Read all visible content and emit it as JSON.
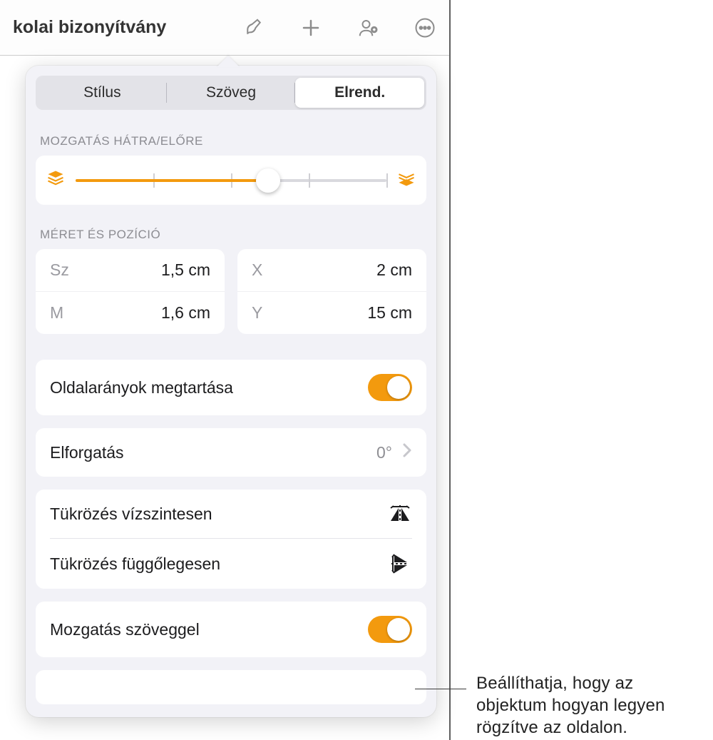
{
  "topbar": {
    "title": "kolai bizonyítvány"
  },
  "tabs": {
    "style": "Stílus",
    "text": "Szöveg",
    "layout": "Elrend."
  },
  "sections": {
    "move_label": "MOZGATÁS HÁTRA/ELŐRE",
    "size_label": "MÉRET ÉS POZÍCIÓ"
  },
  "size": {
    "w_key": "Sz",
    "w_val": "1,5 cm",
    "h_key": "M",
    "h_val": "1,6 cm",
    "x_key": "X",
    "x_val": "2 cm",
    "y_key": "Y",
    "y_val": "15 cm"
  },
  "rows": {
    "constrain": "Oldalarányok megtartása",
    "rotate": "Elforgatás",
    "rotate_val": "0°",
    "flip_h": "Tükrözés vízszintesen",
    "flip_v": "Tükrözés függőlegesen",
    "move_with_text": "Mozgatás szöveggel"
  },
  "callout": "Beállíthatja, hogy az objektum hogyan legyen rögzítve az oldalon."
}
